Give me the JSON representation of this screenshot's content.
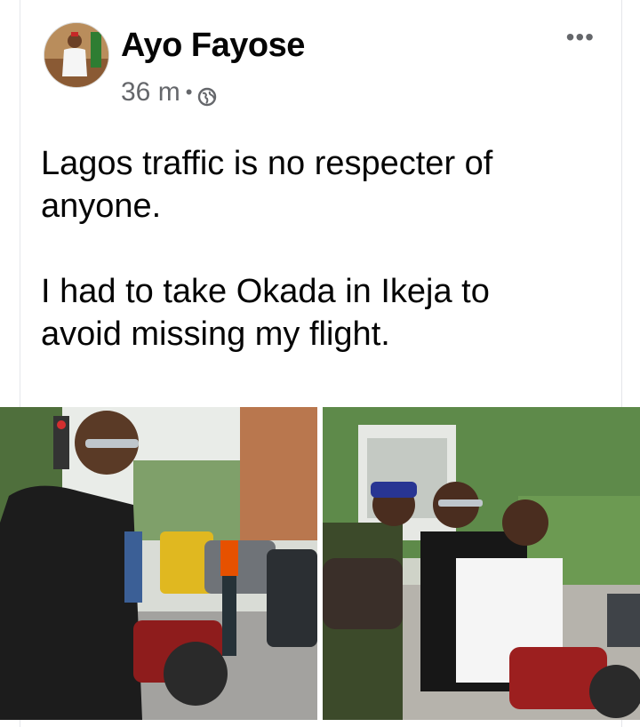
{
  "post": {
    "author": "Ayo Fayose",
    "timestamp": "36 m",
    "separator": "•",
    "audience_icon": "globe-icon",
    "more_label": "•••",
    "text_line_1": "Lagos traffic is no respecter of",
    "text_line_2": "anyone.",
    "text_line_3": "I had to take Okada in Ikeja to",
    "text_line_4": "avoid missing my flight."
  },
  "photos": [
    {
      "description_icon": "photo-okada-street"
    },
    {
      "description_icon": "photo-okada-riders"
    }
  ],
  "colors": {
    "text_primary": "#050505",
    "text_secondary": "#65676b",
    "border": "#e4e6ea"
  }
}
